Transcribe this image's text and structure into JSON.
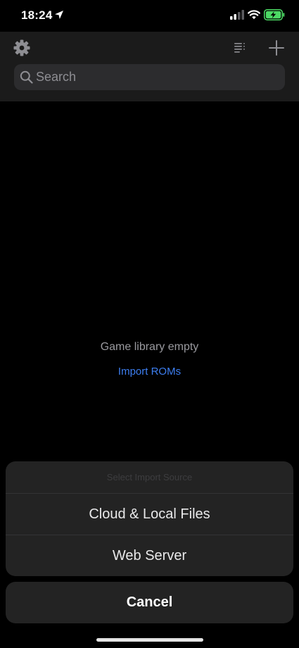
{
  "status_bar": {
    "time": "18:24",
    "icons": [
      "location-icon",
      "signal-icon",
      "wifi-icon",
      "battery-charging-icon"
    ],
    "battery_color": "#4cd964"
  },
  "toolbar": {
    "icons": [
      "gear-icon",
      "sort-icon",
      "add-icon"
    ]
  },
  "search": {
    "placeholder": "Search",
    "value": ""
  },
  "empty_state": {
    "title": "Game library empty",
    "action_label": "Import ROMs"
  },
  "action_sheet": {
    "title": "Select Import Source",
    "options": [
      {
        "label": "Cloud & Local Files"
      },
      {
        "label": "Web Server"
      }
    ],
    "cancel_label": "Cancel"
  },
  "colors": {
    "accent": "#3d7ef0",
    "background": "#000000",
    "nav_background": "#1b1b1b",
    "sheet_background": "#232323"
  }
}
